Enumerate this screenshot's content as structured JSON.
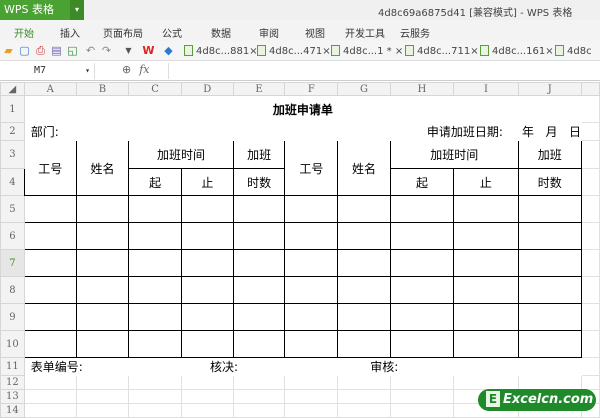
{
  "app": {
    "name": "WPS 表格",
    "window_title": "4d8c69a6875d41 [兼容模式] - WPS 表格"
  },
  "menu": [
    "开始",
    "插入",
    "页面布局",
    "公式",
    "数据",
    "审阅",
    "视图",
    "开发工具",
    "云服务"
  ],
  "doc_tabs": [
    "4d8c...881",
    "4d8c...471",
    "4d8c...1 *",
    "4d8c...711",
    "4d8c...161",
    "4d8c"
  ],
  "formula_bar": {
    "cell_ref": "M7",
    "fx": "fx",
    "value": ""
  },
  "columns": [
    "A",
    "B",
    "C",
    "D",
    "E",
    "F",
    "G",
    "H",
    "I",
    "J"
  ],
  "rows": [
    "1",
    "2",
    "3",
    "4",
    "5",
    "6",
    "7",
    "8",
    "9",
    "10",
    "11",
    "12",
    "13",
    "14"
  ],
  "form": {
    "title": "加班申请单",
    "dept_label": "部门:",
    "date_label": "申请加班日期:",
    "year": "年",
    "month": "月",
    "day": "日",
    "h_id": "工号",
    "h_name": "姓名",
    "h_time": "加班时间",
    "h_start": "起",
    "h_end": "止",
    "h_ot": "加班",
    "h_hours": "时数",
    "form_no": "表单编号:",
    "approve": "核决:",
    "review": "审核:"
  },
  "watermark": "Excelcn.com"
}
